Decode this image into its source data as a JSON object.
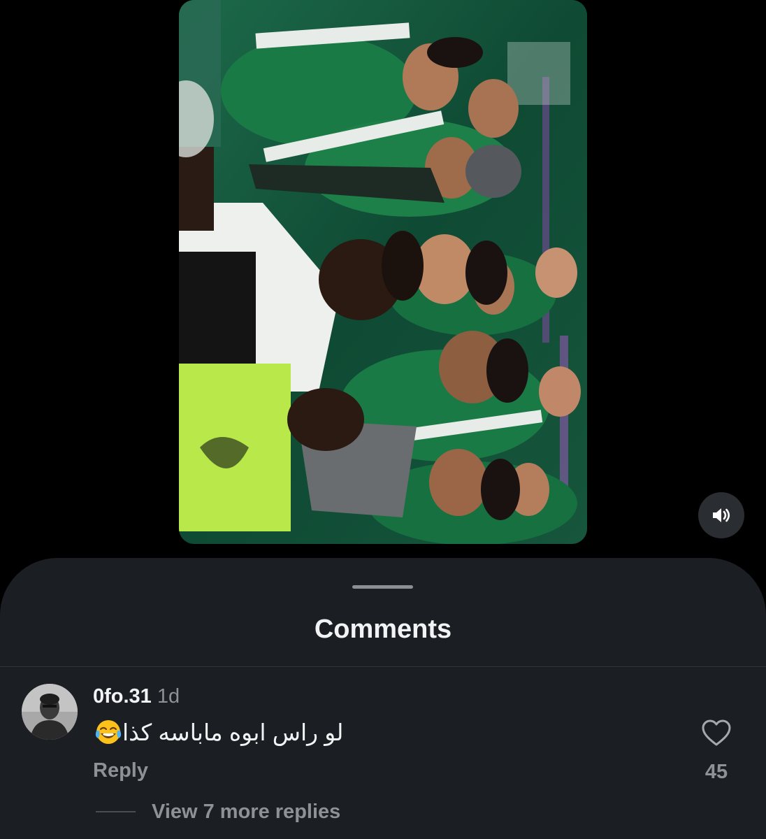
{
  "video": {
    "icon": "speaker-icon",
    "accent_color": "#1f7a4a",
    "sound_state": "on"
  },
  "sheet": {
    "title": "Comments",
    "background_color": "#1b1e22"
  },
  "comment": {
    "username": "0fo.31",
    "timestamp": "1d",
    "text": "لو راس ابوه ماباسه كذا",
    "emoji": "face-with-tears-of-joy",
    "reply_label": "Reply",
    "like_count": "45",
    "view_replies_label": "View 7 more replies"
  }
}
